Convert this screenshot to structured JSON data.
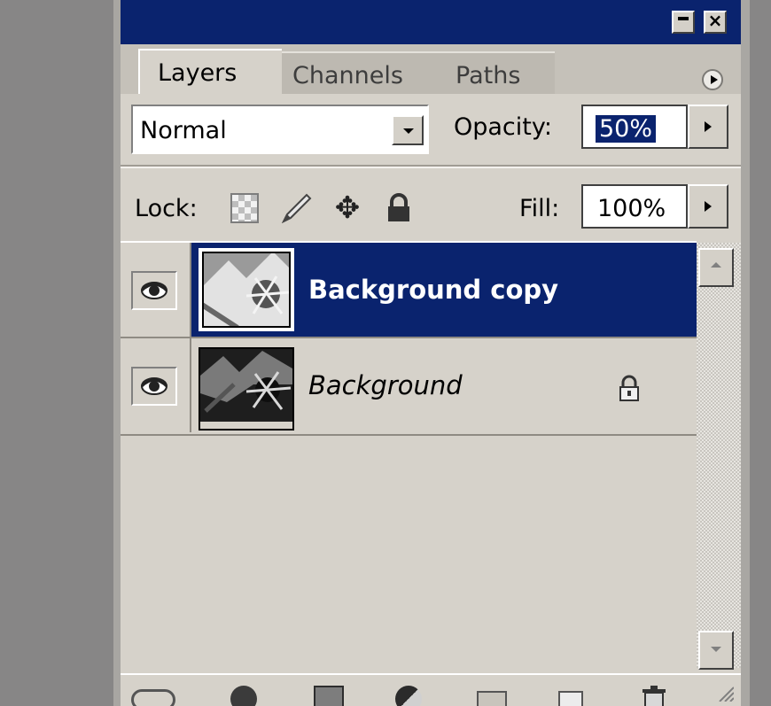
{
  "window": {
    "minimize_icon": "minimize-icon",
    "close_icon": "close-icon"
  },
  "tabs": [
    {
      "label": "Layers",
      "active": true
    },
    {
      "label": "Channels",
      "active": false
    },
    {
      "label": "Paths",
      "active": false
    }
  ],
  "blend_mode": {
    "value": "Normal"
  },
  "opacity": {
    "label": "Opacity:",
    "value": "50%"
  },
  "lock": {
    "label": "Lock:",
    "icons": [
      "lock-transparent-icon",
      "lock-image-icon",
      "lock-position-icon",
      "lock-all-icon"
    ]
  },
  "fill": {
    "label": "Fill:",
    "value": "100%"
  },
  "layers": [
    {
      "name": "Background copy",
      "visible": true,
      "selected": true,
      "locked": false
    },
    {
      "name": "Background",
      "visible": true,
      "selected": false,
      "locked": true
    }
  ],
  "bottom_toolbar": {
    "icons": [
      "link-layers-icon",
      "layer-style-icon",
      "layer-mask-icon",
      "adjustment-layer-icon",
      "new-group-icon",
      "new-layer-icon",
      "trash-icon"
    ]
  },
  "colors": {
    "titlebar": "#0a236e",
    "selection": "#0a236e",
    "panel": "#d6d2ca"
  }
}
